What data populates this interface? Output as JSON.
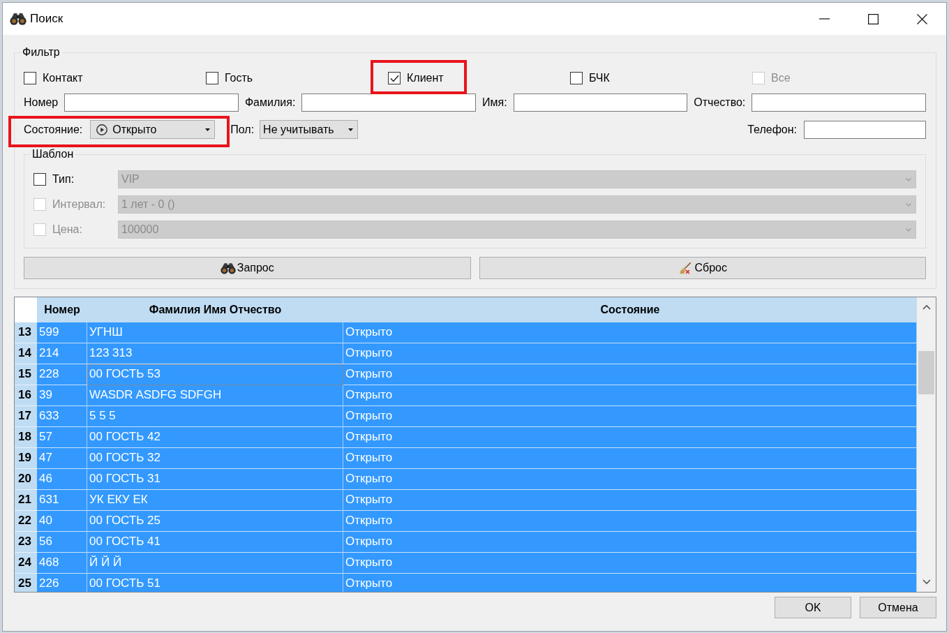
{
  "window": {
    "title": "Поиск"
  },
  "filter": {
    "title": "Фильтр",
    "categories": [
      {
        "label": "Контакт",
        "checked": false,
        "disabled": false,
        "highlighted": false
      },
      {
        "label": "Гость",
        "checked": false,
        "disabled": false,
        "highlighted": false
      },
      {
        "label": "Клиент",
        "checked": true,
        "disabled": false,
        "highlighted": true
      },
      {
        "label": "БЧК",
        "checked": false,
        "disabled": false,
        "highlighted": false
      },
      {
        "label": "Все",
        "checked": false,
        "disabled": true,
        "highlighted": false
      }
    ],
    "fields": [
      {
        "label": "Номер"
      },
      {
        "label": "Фамилия:"
      },
      {
        "label": "Имя:"
      },
      {
        "label": "Отчество:"
      }
    ],
    "state": {
      "label": "Состояние:",
      "value": "Открыто",
      "highlighted": true
    },
    "gender": {
      "label": "Пол:",
      "value": "Не учитывать"
    },
    "phone": {
      "label": "Телефон:"
    },
    "template": {
      "title": "Шаблон",
      "rows": [
        {
          "label": "Тип:",
          "value": "VIP",
          "checked": false,
          "disabled": false
        },
        {
          "label": "Интервал:",
          "value": "1 лет - 0 ()",
          "checked": false,
          "disabled": true
        },
        {
          "label": "Цена:",
          "value": "100000",
          "checked": false,
          "disabled": true
        }
      ]
    },
    "buttons": [
      {
        "label": "Запрос",
        "kind": "query"
      },
      {
        "label": "Сброс",
        "kind": "reset"
      }
    ]
  },
  "table": {
    "columns": [
      "Номер",
      "Фамилия Имя Отчество",
      "Состояние"
    ],
    "rows": [
      {
        "index": "13",
        "number": "599",
        "name": "УГНШ",
        "state": "Открыто",
        "selected": true,
        "focused": false
      },
      {
        "index": "14",
        "number": "214",
        "name": "123 313",
        "state": "Открыто",
        "selected": true,
        "focused": false
      },
      {
        "index": "15",
        "number": "228",
        "name": "00 ГОСТЬ 53",
        "state": "Открыто",
        "selected": true,
        "focused": true
      },
      {
        "index": "16",
        "number": "39",
        "name": "WASDR ASDFG SDFGH",
        "state": "Открыто",
        "selected": true,
        "focused": false
      },
      {
        "index": "17",
        "number": "633",
        "name": "5 5 5",
        "state": "Открыто",
        "selected": true,
        "focused": false
      },
      {
        "index": "18",
        "number": "57",
        "name": "00 ГОСТЬ 42",
        "state": "Открыто",
        "selected": true,
        "focused": false
      },
      {
        "index": "19",
        "number": "47",
        "name": "00 ГОСТЬ 32",
        "state": "Открыто",
        "selected": true,
        "focused": false
      },
      {
        "index": "20",
        "number": "46",
        "name": "00 ГОСТЬ 31",
        "state": "Открыто",
        "selected": true,
        "focused": false
      },
      {
        "index": "21",
        "number": "631",
        "name": "УК ЕКУ ЕК",
        "state": "Открыто",
        "selected": true,
        "focused": false
      },
      {
        "index": "22",
        "number": "40",
        "name": "00 ГОСТЬ 25",
        "state": "Открыто",
        "selected": true,
        "focused": false
      },
      {
        "index": "23",
        "number": "56",
        "name": "00 ГОСТЬ 41",
        "state": "Открыто",
        "selected": true,
        "focused": false
      },
      {
        "index": "24",
        "number": "468",
        "name": "Й Й Й",
        "state": "Открыто",
        "selected": true,
        "focused": false
      },
      {
        "index": "25",
        "number": "226",
        "name": "00 ГОСТЬ 51",
        "state": "Открыто",
        "selected": true,
        "focused": false
      }
    ]
  },
  "buttons": [
    "OK",
    "Отмена"
  ]
}
